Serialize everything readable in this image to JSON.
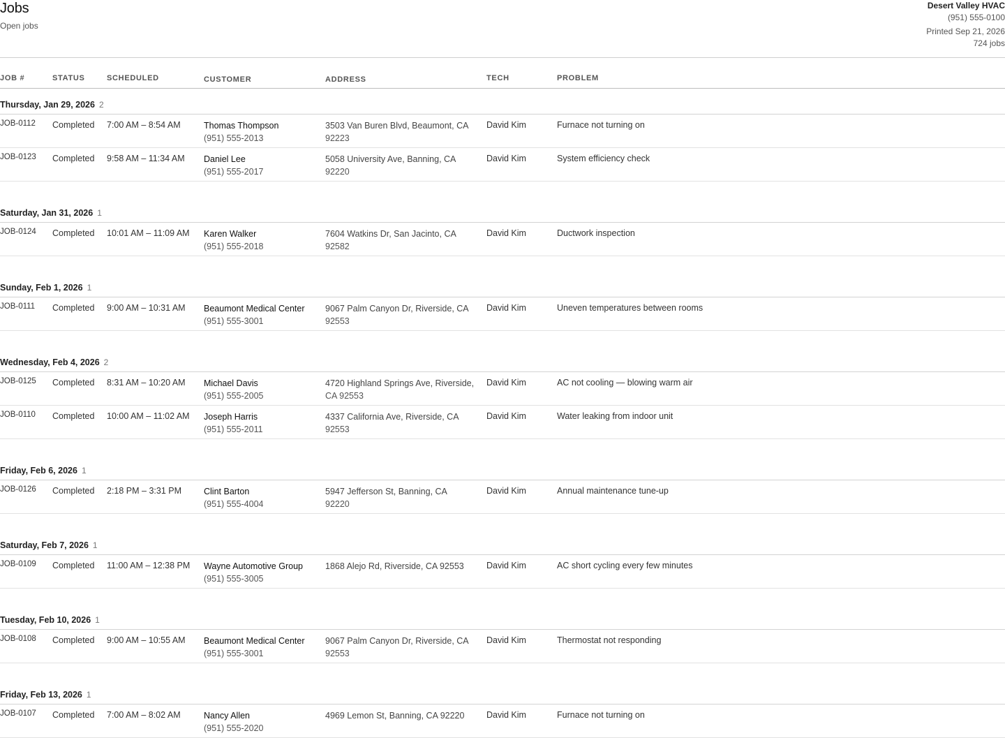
{
  "header": {
    "title": "Jobs",
    "subtitle": "Open jobs",
    "company": "Desert Valley HVAC",
    "phone": "(951) 555-0100",
    "printed": "Printed Sep 21, 2026",
    "count": "724 jobs"
  },
  "columns": {
    "job": "JOB #",
    "status": "STATUS",
    "scheduled": "SCHEDULED",
    "customer": "CUSTOMER",
    "address": "ADDRESS",
    "tech": "TECH",
    "problem": "PROBLEM"
  },
  "groups": [
    {
      "date": "Thursday, Jan 29, 2026",
      "count": "2",
      "jobs": [
        {
          "id": "JOB-0112",
          "status": "Completed",
          "time": "7:00 AM – 8:54 AM",
          "customer": "Thomas Thompson",
          "phone": "(951) 555-2013",
          "addr1": "3503 Van Buren Blvd, Beaumont, CA",
          "addr2": "92223",
          "tech": "David Kim",
          "problem": "Furnace not turning on"
        },
        {
          "id": "JOB-0123",
          "status": "Completed",
          "time": "9:58 AM – 11:34 AM",
          "customer": "Daniel Lee",
          "phone": "(951) 555-2017",
          "addr1": "5058 University Ave, Banning, CA",
          "addr2": "92220",
          "tech": "David Kim",
          "problem": "System efficiency check"
        }
      ]
    },
    {
      "date": "Saturday, Jan 31, 2026",
      "count": "1",
      "jobs": [
        {
          "id": "JOB-0124",
          "status": "Completed",
          "time": "10:01 AM – 11:09 AM",
          "customer": "Karen Walker",
          "phone": "(951) 555-2018",
          "addr1": "7604 Watkins Dr, San Jacinto, CA",
          "addr2": "92582",
          "tech": "David Kim",
          "problem": "Ductwork inspection"
        }
      ]
    },
    {
      "date": "Sunday, Feb 1, 2026",
      "count": "1",
      "jobs": [
        {
          "id": "JOB-0111",
          "status": "Completed",
          "time": "9:00 AM – 10:31 AM",
          "customer": "Beaumont Medical Center",
          "phone": "(951) 555-3001",
          "addr1": "9067 Palm Canyon Dr, Riverside, CA",
          "addr2": "92553",
          "tech": "David Kim",
          "problem": "Uneven temperatures between rooms"
        }
      ]
    },
    {
      "date": "Wednesday, Feb 4, 2026",
      "count": "2",
      "jobs": [
        {
          "id": "JOB-0125",
          "status": "Completed",
          "time": "8:31 AM – 10:20 AM",
          "customer": "Michael Davis",
          "phone": "(951) 555-2005",
          "addr1": "4720 Highland Springs Ave, Riverside,",
          "addr2": "CA 92553",
          "tech": "David Kim",
          "problem": "AC not cooling — blowing warm air"
        },
        {
          "id": "JOB-0110",
          "status": "Completed",
          "time": "10:00 AM – 11:02 AM",
          "customer": "Joseph Harris",
          "phone": "(951) 555-2011",
          "addr1": "4337 California Ave, Riverside, CA",
          "addr2": "92553",
          "tech": "David Kim",
          "problem": "Water leaking from indoor unit"
        }
      ]
    },
    {
      "date": "Friday, Feb 6, 2026",
      "count": "1",
      "jobs": [
        {
          "id": "JOB-0126",
          "status": "Completed",
          "time": "2:18 PM – 3:31 PM",
          "customer": "Clint Barton",
          "phone": "(951) 555-4004",
          "addr1": "5947 Jefferson St, Banning, CA",
          "addr2": "92220",
          "tech": "David Kim",
          "problem": "Annual maintenance tune-up"
        }
      ]
    },
    {
      "date": "Saturday, Feb 7, 2026",
      "count": "1",
      "jobs": [
        {
          "id": "JOB-0109",
          "status": "Completed",
          "time": "11:00 AM – 12:38 PM",
          "customer": "Wayne Automotive Group",
          "phone": "(951) 555-3005",
          "addr1": "1868 Alejo Rd, Riverside, CA 92553",
          "addr2": "",
          "tech": "David Kim",
          "problem": "AC short cycling every few minutes"
        }
      ]
    },
    {
      "date": "Tuesday, Feb 10, 2026",
      "count": "1",
      "jobs": [
        {
          "id": "JOB-0108",
          "status": "Completed",
          "time": "9:00 AM – 10:55 AM",
          "customer": "Beaumont Medical Center",
          "phone": "(951) 555-3001",
          "addr1": "9067 Palm Canyon Dr, Riverside, CA",
          "addr2": "92553",
          "tech": "David Kim",
          "problem": "Thermostat not responding"
        }
      ]
    },
    {
      "date": "Friday, Feb 13, 2026",
      "count": "1",
      "jobs": [
        {
          "id": "JOB-0107",
          "status": "Completed",
          "time": "7:00 AM – 8:02 AM",
          "customer": "Nancy Allen",
          "phone": "(951) 555-2020",
          "addr1": "4969 Lemon St, Banning, CA 92220",
          "addr2": "",
          "tech": "David Kim",
          "problem": "Furnace not turning on"
        }
      ]
    }
  ]
}
